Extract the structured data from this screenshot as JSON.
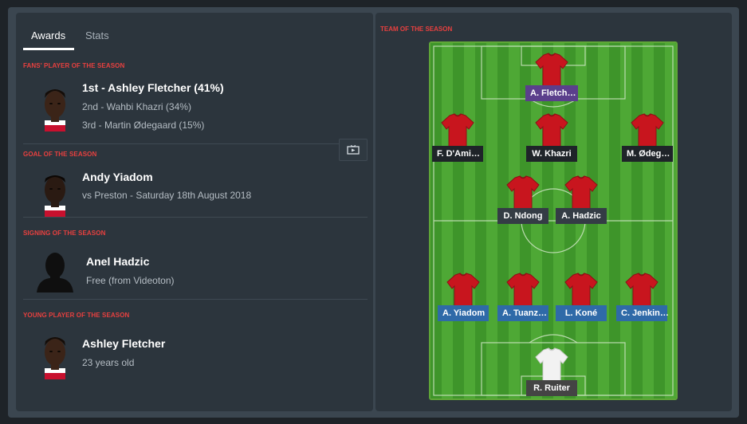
{
  "tabs": {
    "awards": "Awards",
    "stats": "Stats"
  },
  "fans_player": {
    "title": "FANS' PLAYER OF THE SEASON",
    "first": "1st - Ashley Fletcher (41%)",
    "second": "2nd - Wahbi Khazri (34%)",
    "third": "3rd - Martin Ødegaard (15%)"
  },
  "goal": {
    "title": "GOAL OF THE SEASON",
    "name": "Andy Yiadom",
    "detail": "vs Preston - Saturday 18th August 2018"
  },
  "signing": {
    "title": "SIGNING OF THE SEASON",
    "name": "Anel Hadzic",
    "detail": "Free (from Videoton)"
  },
  "young": {
    "title": "YOUNG PLAYER OF THE SEASON",
    "name": "Ashley Fletcher",
    "detail": "23 years old"
  },
  "team": {
    "title": "TEAM OF THE SEASON",
    "players": [
      {
        "name": "A. Fletch…",
        "role": "striker",
        "kit": "red"
      },
      {
        "name": "F. D'Ami…",
        "role": "midfield",
        "kit": "red"
      },
      {
        "name": "W. Khazri",
        "role": "midfield",
        "kit": "red"
      },
      {
        "name": "M. Ødeg…",
        "role": "midfield",
        "kit": "red"
      },
      {
        "name": "D. Ndong",
        "role": "midfield",
        "kit": "red"
      },
      {
        "name": "A. Hadzic",
        "role": "midfield",
        "kit": "red"
      },
      {
        "name": "A. Yiadom",
        "role": "defence",
        "kit": "red"
      },
      {
        "name": "A. Tuanz…",
        "role": "defence",
        "kit": "red"
      },
      {
        "name": "L. Koné",
        "role": "defence",
        "kit": "red"
      },
      {
        "name": "C. Jenkin…",
        "role": "defence",
        "kit": "red"
      },
      {
        "name": "R. Ruiter",
        "role": "goalkeeper",
        "kit": "white"
      }
    ]
  },
  "colors": {
    "accent_red": "#e8403f",
    "striker_tag": "#5b3f8c",
    "midfield_tag": "#1f2429",
    "center_mid_tag": "#343c45",
    "defence_tag": "#2f6aa8",
    "gk_tag": "#444444",
    "pitch_light": "#4ea835",
    "pitch_dark": "#3e952a"
  },
  "icons": {
    "video": "video-icon",
    "shirt": "shirt-icon"
  }
}
